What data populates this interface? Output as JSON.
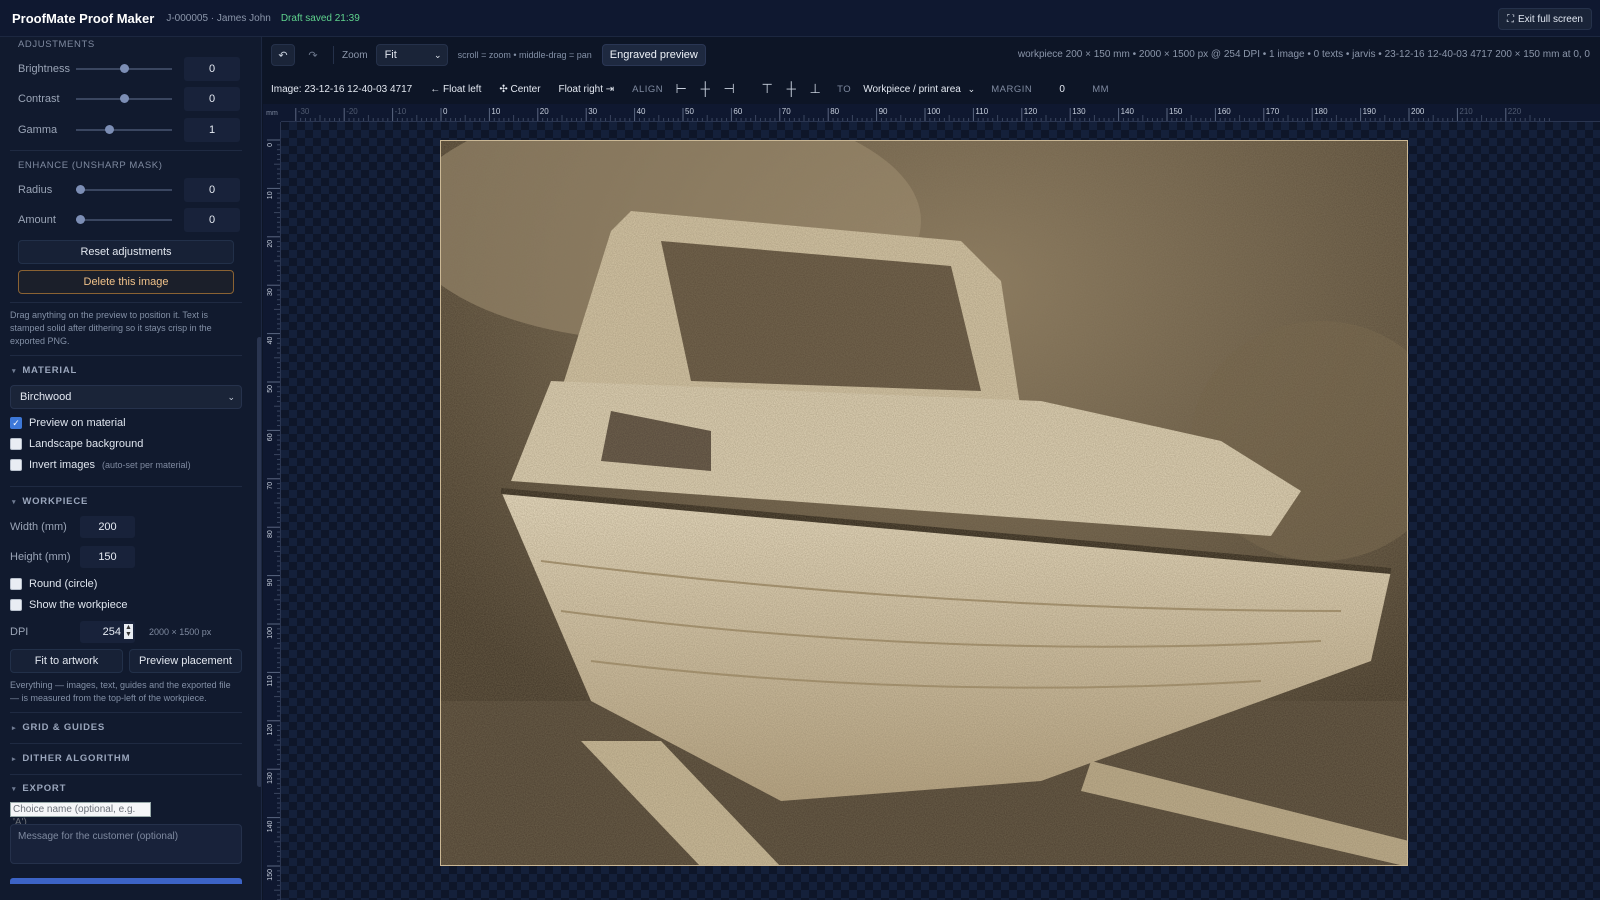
{
  "app": {
    "title": "ProofMate Proof Maker",
    "job": "J-000005 · James John",
    "draft_status": "Draft saved 21:39",
    "exit_fullscreen": "Exit full screen"
  },
  "adjustments": {
    "heading": "ADJUSTMENTS",
    "brightness": {
      "label": "Brightness",
      "value": "0",
      "level": 0.5
    },
    "contrast": {
      "label": "Contrast",
      "value": "0",
      "level": 0.5
    },
    "gamma": {
      "label": "Gamma",
      "value": "1",
      "level": 0.33
    },
    "enhance_heading": "ENHANCE (UNSHARP MASK)",
    "radius": {
      "label": "Radius",
      "value": "0",
      "level": 0
    },
    "amount": {
      "label": "Amount",
      "value": "0",
      "level": 0
    },
    "reset": "Reset adjustments",
    "delete": "Delete this image",
    "hint": "Drag anything on the preview to position it. Text is stamped solid after dithering so it stays crisp in the exported PNG."
  },
  "material": {
    "heading": "MATERIAL",
    "selected": "Birchwood",
    "preview_on_material": "Preview on material",
    "landscape_background": "Landscape background",
    "invert_images": "Invert images",
    "invert_note": "(auto-set per material)"
  },
  "workpiece": {
    "heading": "WORKPIECE",
    "width_label": "Width (mm)",
    "width": "200",
    "height_label": "Height (mm)",
    "height": "150",
    "round": "Round (circle)",
    "show": "Show the workpiece",
    "dpi_label": "DPI",
    "dpi": "254",
    "px_size": "2000 × 1500 px",
    "fit_artwork": "Fit to artwork",
    "preview_placement": "Preview placement",
    "hint": "Everything — images, text, guides and the exported file — is measured from the top-left of the workpiece."
  },
  "sections": {
    "grid": "GRID & GUIDES",
    "dither": "DITHER ALGORITHM",
    "export": "EXPORT"
  },
  "export": {
    "choice_placeholder": "Choice name (optional, e.g. 'A')",
    "message_placeholder": "Message for the customer (optional)"
  },
  "toolbar": {
    "undo": "↶",
    "redo": "↷",
    "zoom_label": "Zoom",
    "zoom_value": "Fit",
    "hint": "scroll = zoom • middle-drag = pan",
    "engraved_preview": "Engraved preview",
    "status": "workpiece 200 × 150 mm • 2000 × 1500 px @ 254 DPI • 1 image • 0 texts • jarvis • 23-12-16 12-40-03 4717 200 × 150 mm at 0, 0"
  },
  "toolbar2": {
    "image_name": "Image: 23-12-16 12-40-03 4717",
    "float_left": "← Float left",
    "center": "✣ Center",
    "float_right": "Float right ⇥",
    "align_label": "ALIGN",
    "to_label": "TO",
    "to_value": "Workpiece / print area",
    "margin_label": "MARGIN",
    "margin_value": "0",
    "unit": "MM"
  },
  "ruler": {
    "unit": "mm",
    "top_labels": [
      "-30",
      "-20",
      "-10",
      "0",
      "10",
      "20",
      "30",
      "40",
      "50",
      "60",
      "70",
      "80",
      "90",
      "100",
      "110",
      "120",
      "130",
      "140",
      "150",
      "160",
      "170",
      "180",
      "190",
      "200",
      "210",
      "220"
    ],
    "left_labels": [
      "0",
      "10",
      "20",
      "30",
      "40",
      "50",
      "60",
      "70",
      "80",
      "90",
      "100",
      "110",
      "120",
      "130",
      "140",
      "150"
    ]
  },
  "colors": {
    "accent": "#3d78d8",
    "success": "#5fd38d",
    "danger_border": "#8a6233",
    "sepia": "#e8d9b8"
  }
}
